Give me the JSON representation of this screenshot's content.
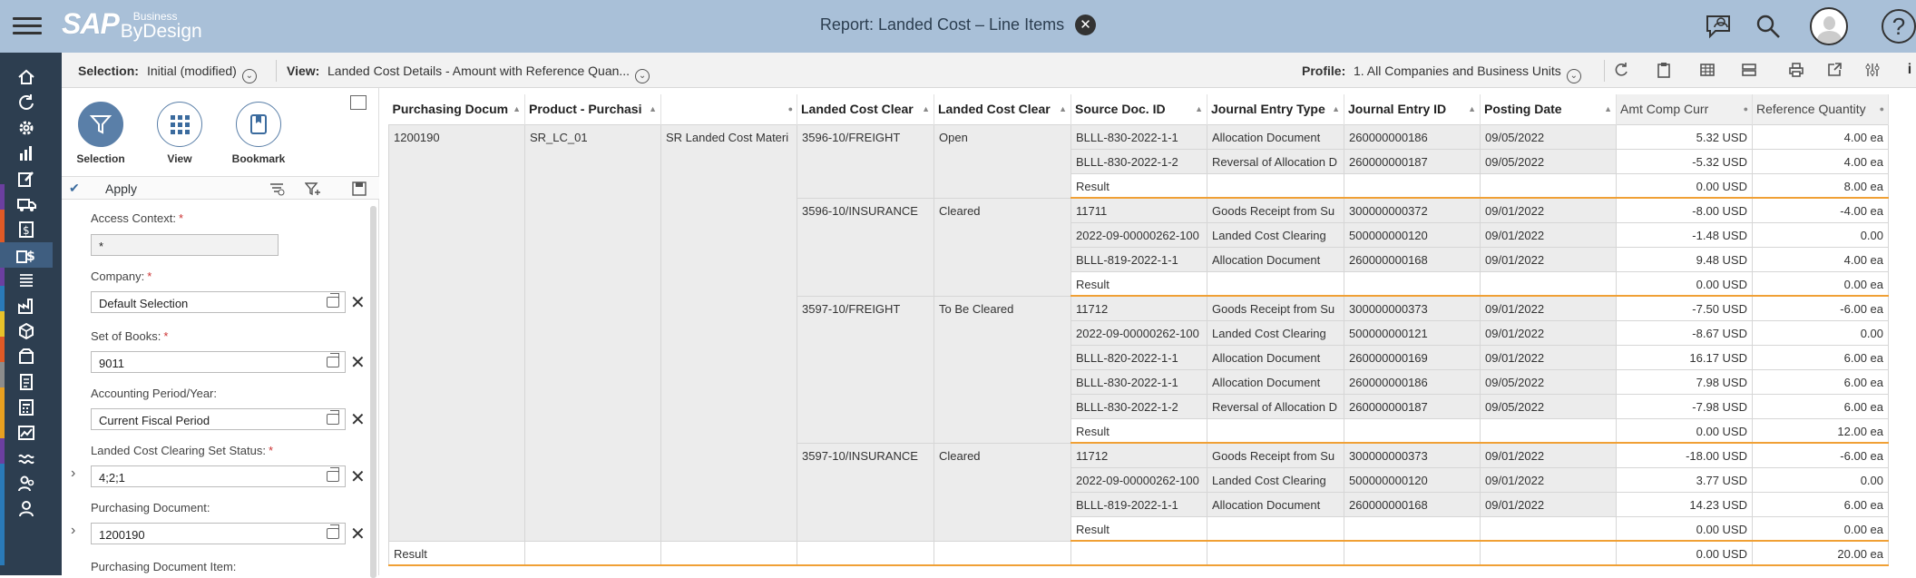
{
  "shell": {
    "title": "Report: Landed Cost – Line Items",
    "logo_main": "SAP",
    "logo_top": "Business",
    "logo_bottom": "ByDesign"
  },
  "toolbar": {
    "selection_label": "Selection:",
    "selection_value": "Initial (modified)",
    "view_label": "View:",
    "view_value": "Landed Cost Details - Amount with Reference Quan...",
    "profile_label": "Profile:",
    "profile_value": "1. All Companies and Business Units"
  },
  "sidepanel": {
    "buttons": [
      "Selection",
      "View",
      "Bookmark"
    ],
    "apply": "Apply"
  },
  "filters": [
    {
      "label": "Access Context:",
      "required": true,
      "value": "*"
    },
    {
      "label": "Company:",
      "required": true,
      "value": "Default Selection"
    },
    {
      "label": "Set of Books:",
      "required": true,
      "value": "9011"
    },
    {
      "label": "Accounting Period/Year:",
      "required": false,
      "value": "Current Fiscal Period"
    },
    {
      "label": "Landed Cost Clearing Set Status:",
      "required": true,
      "value": "4;2;1"
    },
    {
      "label": "Purchasing Document:",
      "required": false,
      "value": "1200190"
    },
    {
      "label": "Purchasing Document Item:",
      "required": false,
      "value": ""
    }
  ],
  "columns": [
    "Purchasing Docum",
    "Product - Purchasi",
    "",
    "Landed Cost Clear",
    "Landed Cost Clear",
    "Source Doc. ID",
    "Journal Entry Type",
    "Journal Entry ID",
    "Posting Date",
    "Amt Comp Curr",
    "Reference Quantity"
  ],
  "groups": [
    {
      "purchasing_doc": "1200190",
      "product": "SR_LC_01",
      "product_desc": "SR Landed Cost Materi",
      "clearing": "3596-10/FREIGHT",
      "status": "Open",
      "rows": [
        [
          "BLLL-830-2022-1-1",
          "Allocation Document",
          "260000000186",
          "09/05/2022",
          "5.32 USD",
          "4.00 ea"
        ],
        [
          "BLLL-830-2022-1-2",
          "Reversal of Allocation D",
          "260000000187",
          "09/05/2022",
          "-5.32 USD",
          "4.00 ea"
        ]
      ],
      "result": [
        "0.00 USD",
        "8.00 ea"
      ]
    },
    {
      "clearing": "3596-10/INSURANCE",
      "status": "Cleared",
      "rows": [
        [
          "11711",
          "Goods Receipt from Su",
          "300000000372",
          "09/01/2022",
          "-8.00 USD",
          "-4.00 ea"
        ],
        [
          "2022-09-00000262-100",
          "Landed Cost Clearing",
          "500000000120",
          "09/01/2022",
          "-1.48 USD",
          "0.00"
        ],
        [
          "BLLL-819-2022-1-1",
          "Allocation Document",
          "260000000168",
          "09/01/2022",
          "9.48 USD",
          "4.00 ea"
        ]
      ],
      "result": [
        "0.00 USD",
        "0.00 ea"
      ]
    },
    {
      "clearing": "3597-10/FREIGHT",
      "status": "To Be Cleared",
      "rows": [
        [
          "11712",
          "Goods Receipt from Su",
          "300000000373",
          "09/01/2022",
          "-7.50 USD",
          "-6.00 ea"
        ],
        [
          "2022-09-00000262-100",
          "Landed Cost Clearing",
          "500000000121",
          "09/01/2022",
          "-8.67 USD",
          "0.00"
        ],
        [
          "BLLL-820-2022-1-1",
          "Allocation Document",
          "260000000169",
          "09/01/2022",
          "16.17 USD",
          "6.00 ea"
        ],
        [
          "BLLL-830-2022-1-1",
          "Allocation Document",
          "260000000186",
          "09/05/2022",
          "7.98 USD",
          "6.00 ea"
        ],
        [
          "BLLL-830-2022-1-2",
          "Reversal of Allocation D",
          "260000000187",
          "09/05/2022",
          "-7.98 USD",
          "6.00 ea"
        ]
      ],
      "result": [
        "0.00 USD",
        "12.00 ea"
      ]
    },
    {
      "clearing": "3597-10/INSURANCE",
      "status": "Cleared",
      "rows": [
        [
          "11712",
          "Goods Receipt from Su",
          "300000000373",
          "09/01/2022",
          "-18.00 USD",
          "-6.00 ea"
        ],
        [
          "2022-09-00000262-100",
          "Landed Cost Clearing",
          "500000000120",
          "09/01/2022",
          "3.77 USD",
          "0.00"
        ],
        [
          "BLLL-819-2022-1-1",
          "Allocation Document",
          "260000000168",
          "09/01/2022",
          "14.23 USD",
          "6.00 ea"
        ]
      ],
      "result": [
        "0.00 USD",
        "0.00 ea"
      ]
    }
  ],
  "result_label": "Result",
  "grand_total": [
    "0.00 USD",
    "20.00 ea"
  ]
}
